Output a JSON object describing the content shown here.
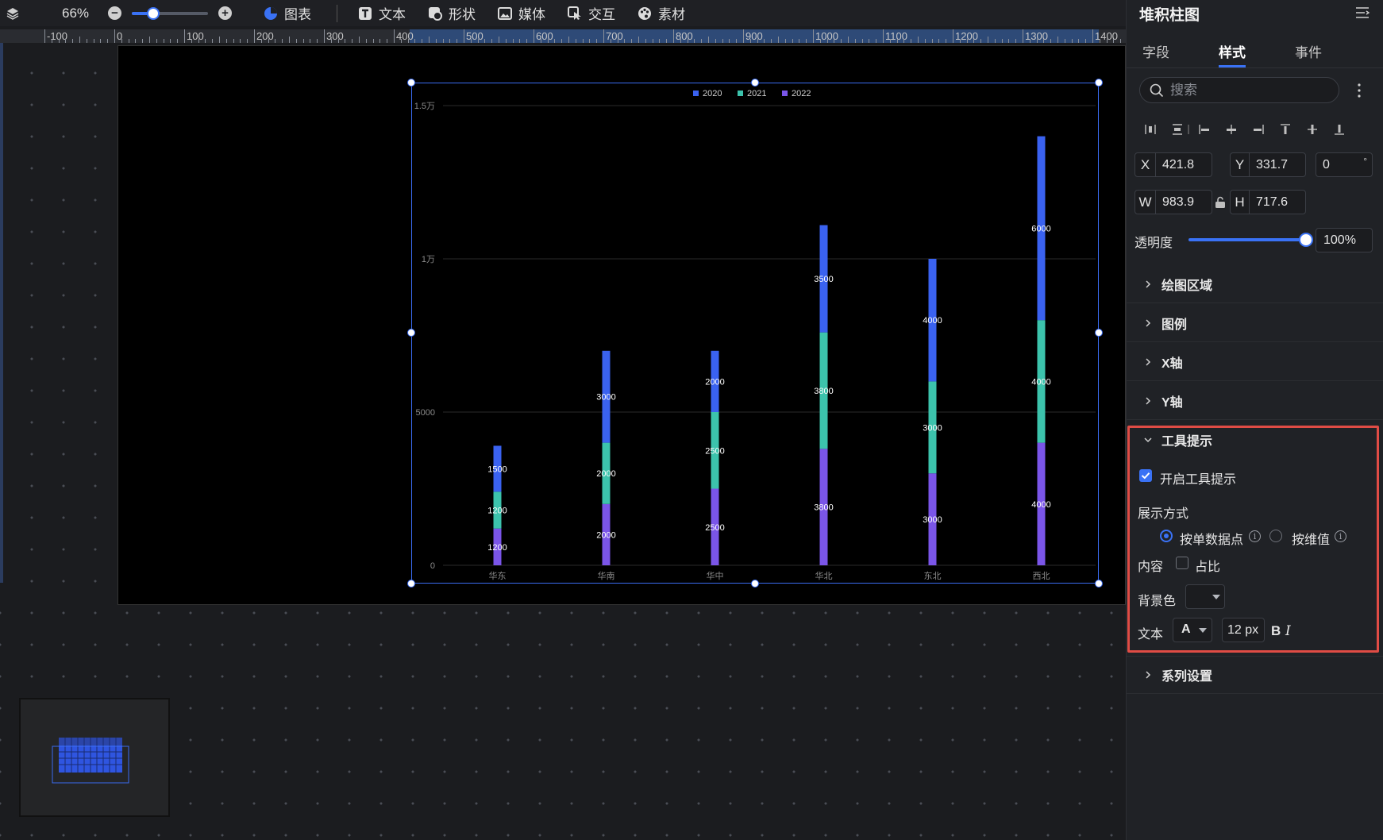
{
  "toolbar": {
    "zoom": "66%",
    "items": [
      {
        "label": "图表",
        "icon": "chart-pie-icon"
      },
      {
        "label": "文本",
        "icon": "text-icon"
      },
      {
        "label": "形状",
        "icon": "shape-icon"
      },
      {
        "label": "媒体",
        "icon": "image-icon"
      },
      {
        "label": "交互",
        "icon": "interaction-icon"
      },
      {
        "label": "素材",
        "icon": "palette-icon"
      }
    ]
  },
  "ruler": {
    "labels": [
      "-100",
      "0",
      "100",
      "200",
      "300",
      "400",
      "500",
      "600",
      "700",
      "800",
      "900",
      "1000",
      "1100",
      "1200",
      "1300",
      "1400"
    ]
  },
  "panel": {
    "title": "堆积柱图",
    "tabs": [
      "字段",
      "样式",
      "事件"
    ],
    "active_tab": "样式",
    "search_placeholder": "搜索",
    "position": {
      "x_label": "X",
      "x": "421.8",
      "y_label": "Y",
      "y": "331.7",
      "rotation": "0",
      "rotation_unit": "°"
    },
    "size": {
      "w_label": "W",
      "w": "983.9",
      "h_label": "H",
      "h": "717.6"
    },
    "opacity_label": "透明度",
    "opacity_value": "100%",
    "opacity_level": 1.0,
    "sections": [
      "绘图区域",
      "图例",
      "X轴",
      "Y轴"
    ],
    "tooltip": {
      "title": "工具提示",
      "enable_label": "开启工具提示",
      "enabled": true,
      "mode_label": "展示方式",
      "mode_option1": "按单数据点",
      "mode_option2": "按维值",
      "selected_mode": "按单数据点",
      "content_label": "内容",
      "percent_label": "占比",
      "percent_checked": false,
      "bg_label": "背景色",
      "text_label": "文本",
      "font_glyph": "A",
      "font_size": "12 px",
      "bold": "B",
      "italic": "I"
    },
    "series_section": "系列设置"
  },
  "chart_data": {
    "type": "bar",
    "stacked": true,
    "categories": [
      "华东",
      "华南",
      "华中",
      "华北",
      "东北",
      "西北"
    ],
    "series": [
      {
        "name": "2022",
        "color": "#7a55e8",
        "values": [
          1200,
          2000,
          2500,
          3800,
          3000,
          4000
        ]
      },
      {
        "name": "2021",
        "color": "#3cc3ac",
        "values": [
          1200,
          2000,
          2500,
          3800,
          3000,
          4000
        ]
      },
      {
        "name": "2020",
        "color": "#3a62f0",
        "values": [
          1500,
          3000,
          2000,
          3500,
          4000,
          6000
        ]
      }
    ],
    "legend": [
      "2020",
      "2021",
      "2022"
    ],
    "legend_position": "top-center",
    "y_ticks": [
      {
        "value": 0,
        "label": "0"
      },
      {
        "value": 5000,
        "label": "5000"
      },
      {
        "value": 10000,
        "label": "1万"
      },
      {
        "value": 15000,
        "label": "1.5万"
      }
    ],
    "ylim": [
      0,
      15000
    ],
    "grid": true
  }
}
